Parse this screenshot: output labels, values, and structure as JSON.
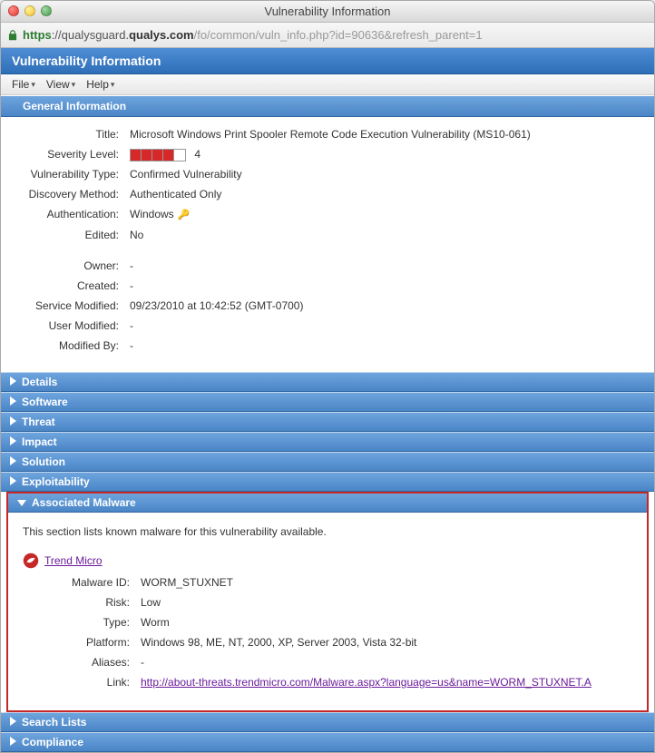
{
  "window": {
    "title": "Vulnerability Information"
  },
  "url": {
    "scheme": "https",
    "host_pre": "://qualysguard.",
    "host_bold": "qualys.com",
    "path": "/fo/common/vuln_info.php?id=90636&refresh_parent=1"
  },
  "header": {
    "title": "Vulnerability Information"
  },
  "menu": {
    "file": "File",
    "view": "View",
    "help": "Help"
  },
  "general_section_title": "General Information",
  "general": {
    "labels": {
      "title": "Title:",
      "severity": "Severity Level:",
      "vuln_type": "Vulnerability Type:",
      "discovery": "Discovery Method:",
      "auth": "Authentication:",
      "edited": "Edited:",
      "owner": "Owner:",
      "created": "Created:",
      "service_mod": "Service Modified:",
      "user_mod": "User Modified:",
      "modified_by": "Modified By:"
    },
    "values": {
      "title": "Microsoft Windows Print Spooler Remote Code Execution Vulnerability (MS10-061)",
      "severity_num": "4",
      "vuln_type": "Confirmed Vulnerability",
      "discovery": "Authenticated Only",
      "auth": "Windows",
      "edited": "No",
      "owner": "-",
      "created": "-",
      "service_mod": "09/23/2010 at 10:42:52 (GMT-0700)",
      "user_mod": "-",
      "modified_by": "-"
    },
    "severity_total": 5,
    "severity_filled": 4
  },
  "accordion": {
    "details": "Details",
    "software": "Software",
    "threat": "Threat",
    "impact": "Impact",
    "solution": "Solution",
    "exploitability": "Exploitability",
    "malware": "Associated Malware",
    "search_lists": "Search Lists",
    "compliance": "Compliance"
  },
  "malware": {
    "intro": "This section lists known malware for this vulnerability available.",
    "vendor": "Trend Micro",
    "labels": {
      "id": "Malware ID:",
      "risk": "Risk:",
      "type": "Type:",
      "platform": "Platform:",
      "aliases": "Aliases:",
      "link": "Link:"
    },
    "values": {
      "id": "WORM_STUXNET",
      "risk": "Low",
      "type": "Worm",
      "platform": "Windows 98, ME, NT, 2000, XP, Server 2003, Vista 32-bit",
      "aliases": "-",
      "link": "http://about-threats.trendmicro.com/Malware.aspx?language=us&name=WORM_STUXNET.A"
    }
  }
}
